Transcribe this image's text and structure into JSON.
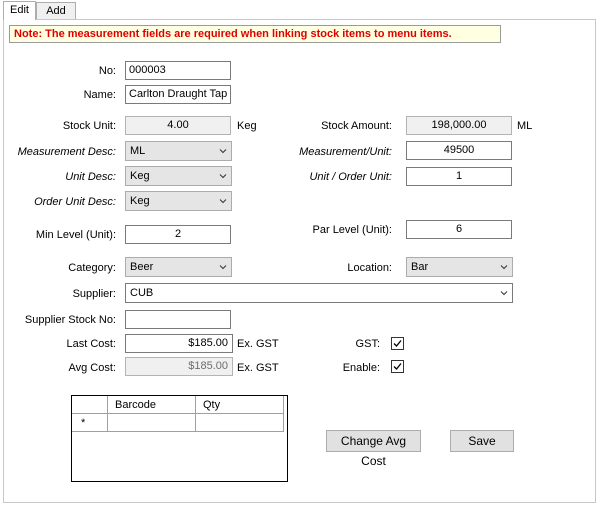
{
  "tabs": [
    {
      "label": "Edit",
      "active": true
    },
    {
      "label": "Add",
      "active": false
    }
  ],
  "note": "Note: The measurement fields are required when linking stock items to menu items.",
  "form": {
    "no_label": "No:",
    "no_value": "000003",
    "name_label": "Name:",
    "name_value": "Carlton Draught Tap",
    "stock_unit_label": "Stock Unit:",
    "stock_unit_value": "4.00",
    "stock_unit_unit": "Keg",
    "stock_amount_label": "Stock Amount:",
    "stock_amount_value": "198,000.00",
    "stock_amount_unit": "ML",
    "measurement_desc_label": "Measurement Desc:",
    "measurement_desc_value": "ML",
    "measurement_unit_label": "Measurement/Unit:",
    "measurement_unit_value": "49500",
    "unit_desc_label": "Unit Desc:",
    "unit_desc_value": "Keg",
    "unit_order_label": "Unit / Order Unit:",
    "unit_order_value": "1",
    "order_unit_desc_label": "Order Unit Desc:",
    "order_unit_desc_value": "Keg",
    "min_level_label": "Min Level (Unit):",
    "min_level_value": "2",
    "par_level_label": "Par Level (Unit):",
    "par_level_value": "6",
    "category_label": "Category:",
    "category_value": "Beer",
    "location_label": "Location:",
    "location_value": "Bar",
    "supplier_label": "Supplier:",
    "supplier_value": "CUB",
    "supplier_stock_no_label": "Supplier Stock No:",
    "supplier_stock_no_value": "",
    "last_cost_label": "Last Cost:",
    "last_cost_value": "$185.00",
    "last_cost_suffix": "Ex. GST",
    "avg_cost_label": "Avg Cost:",
    "avg_cost_value": "$185.00",
    "avg_cost_suffix": "Ex. GST",
    "gst_label": "GST:",
    "gst_checked": true,
    "enable_label": "Enable:",
    "enable_checked": true
  },
  "barcode_grid": {
    "columns": [
      "Barcode",
      "Qty"
    ],
    "new_row_marker": "*"
  },
  "buttons": {
    "change_avg_cost": "Change Avg Cost",
    "save": "Save"
  },
  "colors": {
    "note_text": "#e00000",
    "note_bg": "#ffffe1",
    "readonly_bg": "#f0f0f0",
    "combo_bg": "#e5e5e5",
    "button_bg": "#e1e1e1"
  }
}
